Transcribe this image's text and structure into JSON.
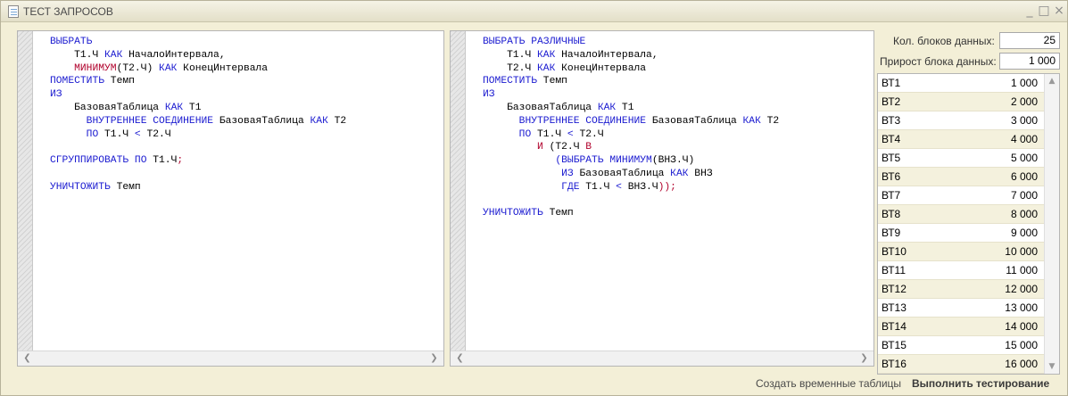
{
  "window": {
    "title": "ТЕСТ ЗАПРОСОВ",
    "minimize": "_",
    "maximize": "□",
    "close": "×"
  },
  "editor_left": {
    "lines": [
      [
        {
          "t": "ВЫБРАТЬ",
          "c": "kw"
        }
      ],
      [
        {
          "t": "    Т1.Ч ",
          "c": ""
        },
        {
          "t": "КАК",
          "c": "kw"
        },
        {
          "t": " НачалоИнтервала,",
          "c": ""
        }
      ],
      [
        {
          "t": "    МИНИМУМ",
          "c": "fn"
        },
        {
          "t": "(Т2.Ч)",
          "c": ""
        },
        {
          "t": " КАК",
          "c": "kw"
        },
        {
          "t": " КонецИнтервала",
          "c": ""
        }
      ],
      [
        {
          "t": "ПОМЕСТИТЬ",
          "c": "kw"
        },
        {
          "t": " Темп",
          "c": ""
        }
      ],
      [
        {
          "t": "ИЗ",
          "c": "kw"
        }
      ],
      [
        {
          "t": "    БазоваяТаблица ",
          "c": ""
        },
        {
          "t": "КАК",
          "c": "kw"
        },
        {
          "t": " Т1",
          "c": ""
        }
      ],
      [
        {
          "t": "      ВНУТРЕННЕЕ СОЕДИНЕНИЕ",
          "c": "kw"
        },
        {
          "t": " БазоваяТаблица ",
          "c": ""
        },
        {
          "t": "КАК",
          "c": "kw"
        },
        {
          "t": " Т2",
          "c": ""
        }
      ],
      [
        {
          "t": "      ПО",
          "c": "kw"
        },
        {
          "t": " Т1.Ч ",
          "c": ""
        },
        {
          "t": "<",
          "c": "kw"
        },
        {
          "t": " Т2.Ч",
          "c": ""
        }
      ],
      [
        {
          "t": "",
          "c": ""
        }
      ],
      [
        {
          "t": "СГРУППИРОВАТЬ ПО",
          "c": "kw"
        },
        {
          "t": " Т1.Ч",
          "c": ""
        },
        {
          "t": ";",
          "c": "fn"
        }
      ],
      [
        {
          "t": "",
          "c": ""
        }
      ],
      [
        {
          "t": "УНИЧТОЖИТЬ",
          "c": "kw"
        },
        {
          "t": " Темп",
          "c": ""
        }
      ]
    ]
  },
  "editor_right": {
    "lines": [
      [
        {
          "t": "ВЫБРАТЬ РАЗЛИЧНЫЕ",
          "c": "kw"
        }
      ],
      [
        {
          "t": "    Т1.Ч ",
          "c": ""
        },
        {
          "t": "КАК",
          "c": "kw"
        },
        {
          "t": " НачалоИнтервала,",
          "c": ""
        }
      ],
      [
        {
          "t": "    Т2.Ч ",
          "c": ""
        },
        {
          "t": "КАК",
          "c": "kw"
        },
        {
          "t": " КонецИнтервала",
          "c": ""
        }
      ],
      [
        {
          "t": "ПОМЕСТИТЬ",
          "c": "kw"
        },
        {
          "t": " Темп",
          "c": ""
        }
      ],
      [
        {
          "t": "ИЗ",
          "c": "kw"
        }
      ],
      [
        {
          "t": "    БазоваяТаблица ",
          "c": ""
        },
        {
          "t": "КАК",
          "c": "kw"
        },
        {
          "t": " Т1",
          "c": ""
        }
      ],
      [
        {
          "t": "      ВНУТРЕННЕЕ СОЕДИНЕНИЕ",
          "c": "kw"
        },
        {
          "t": " БазоваяТаблица ",
          "c": ""
        },
        {
          "t": "КАК",
          "c": "kw"
        },
        {
          "t": " Т2",
          "c": ""
        }
      ],
      [
        {
          "t": "      ПО",
          "c": "kw"
        },
        {
          "t": " Т1.Ч ",
          "c": ""
        },
        {
          "t": "<",
          "c": "kw"
        },
        {
          "t": " Т2.Ч",
          "c": ""
        }
      ],
      [
        {
          "t": "         И",
          "c": "fn"
        },
        {
          "t": " (Т2.Ч ",
          "c": ""
        },
        {
          "t": "В",
          "c": "fn"
        }
      ],
      [
        {
          "t": "            (ВЫБРАТЬ МИНИМУМ",
          "c": "kw"
        },
        {
          "t": "(ВНЗ.Ч)",
          "c": ""
        }
      ],
      [
        {
          "t": "             ИЗ",
          "c": "kw"
        },
        {
          "t": " БазоваяТаблица ",
          "c": ""
        },
        {
          "t": "КАК",
          "c": "kw"
        },
        {
          "t": " ВНЗ",
          "c": ""
        }
      ],
      [
        {
          "t": "             ГДЕ",
          "c": "kw"
        },
        {
          "t": " Т1.Ч ",
          "c": ""
        },
        {
          "t": "<",
          "c": "kw"
        },
        {
          "t": " ВНЗ.Ч",
          "c": ""
        },
        {
          "t": "));",
          "c": "fn"
        }
      ],
      [
        {
          "t": "",
          "c": ""
        }
      ],
      [
        {
          "t": "УНИЧТОЖИТЬ",
          "c": "kw"
        },
        {
          "t": " Темп",
          "c": ""
        }
      ]
    ]
  },
  "params": {
    "blocks_label": "Кол. блоков данных:",
    "blocks_value": "25",
    "growth_label": "Прирост блока данных:",
    "growth_value": "1 000"
  },
  "table": {
    "rows": [
      {
        "name": "ВТ1",
        "value": "1 000"
      },
      {
        "name": "ВТ2",
        "value": "2 000"
      },
      {
        "name": "ВТ3",
        "value": "3 000"
      },
      {
        "name": "ВТ4",
        "value": "4 000"
      },
      {
        "name": "ВТ5",
        "value": "5 000"
      },
      {
        "name": "ВТ6",
        "value": "6 000"
      },
      {
        "name": "ВТ7",
        "value": "7 000"
      },
      {
        "name": "ВТ8",
        "value": "8 000"
      },
      {
        "name": "ВТ9",
        "value": "9 000"
      },
      {
        "name": "ВТ10",
        "value": "10 000"
      },
      {
        "name": "ВТ11",
        "value": "11 000"
      },
      {
        "name": "ВТ12",
        "value": "12 000"
      },
      {
        "name": "ВТ13",
        "value": "13 000"
      },
      {
        "name": "ВТ14",
        "value": "14 000"
      },
      {
        "name": "ВТ15",
        "value": "15 000"
      },
      {
        "name": "ВТ16",
        "value": "16 000"
      }
    ]
  },
  "footer": {
    "create_tables": "Создать временные таблицы",
    "run_test": "Выполнить тестирование"
  },
  "colors": {
    "keyword": "#1a1ad0",
    "function": "#b0002b",
    "row_alt": "#f4f1dd"
  }
}
